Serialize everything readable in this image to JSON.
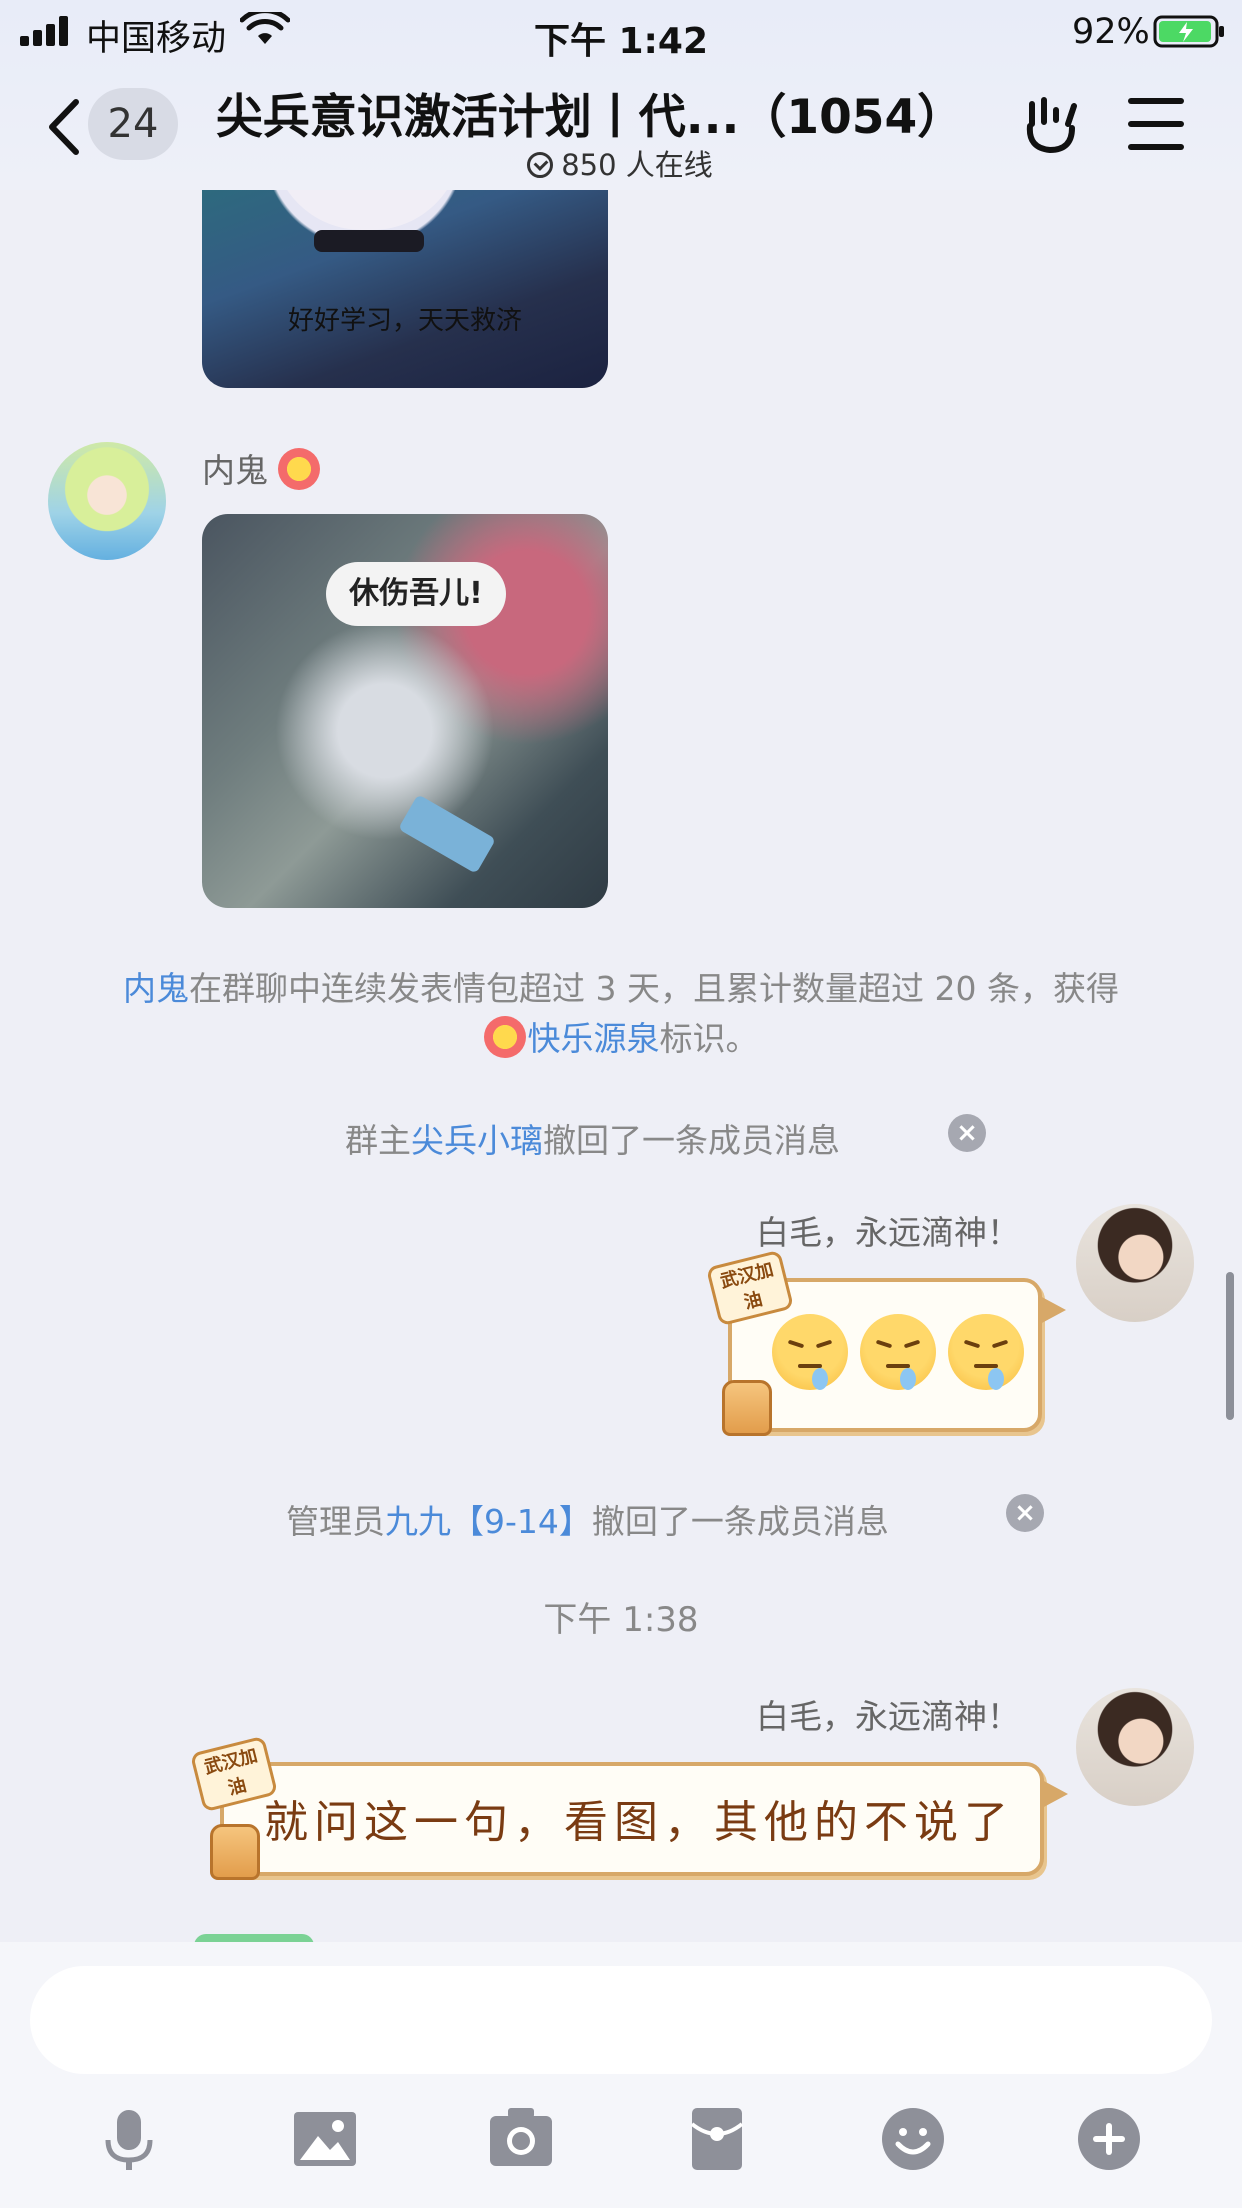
{
  "status_bar": {
    "carrier": "中国移动",
    "time": "下午 1:42",
    "battery": "92%"
  },
  "header": {
    "back_count": "24",
    "title": "尖兵意识激活计划丨代...（1054）",
    "online": "850 人在线"
  },
  "messages": {
    "image1_caption": "好好学习，天天救济",
    "sender1": "内鬼",
    "image2_caption": "休伤吾儿!",
    "notice_user": "内鬼",
    "notice_text": "在群聊中连续发表情包超过 3 天，且累计数量超过 20 条，获得",
    "notice_badge": "快乐源泉",
    "notice_suffix": "标识。",
    "recall1_prefix": "群主",
    "recall1_user": "尖兵小璃",
    "recall1_suffix": "撤回了一条成员消息",
    "sender2": "白毛，永远滴神！",
    "sticker_text": "武汉加油",
    "recall2_prefix": "管理员",
    "recall2_user": "九九【9-14】",
    "recall2_suffix": "撤回了一条成员消息",
    "time_separator": "下午 1:38",
    "sender3": "白毛，永远滴神！",
    "bubble_text": "就问这一句，看图，其他的不说了"
  },
  "input": {
    "placeholder": ""
  },
  "toolbar": {
    "icons": [
      "microphone-icon",
      "image-icon",
      "camera-icon",
      "red-packet-icon",
      "emoji-icon",
      "plus-icon"
    ]
  },
  "colors": {
    "link": "#4b8ad9",
    "bubble_border": "#d7a868",
    "background": "#eeeff6"
  }
}
